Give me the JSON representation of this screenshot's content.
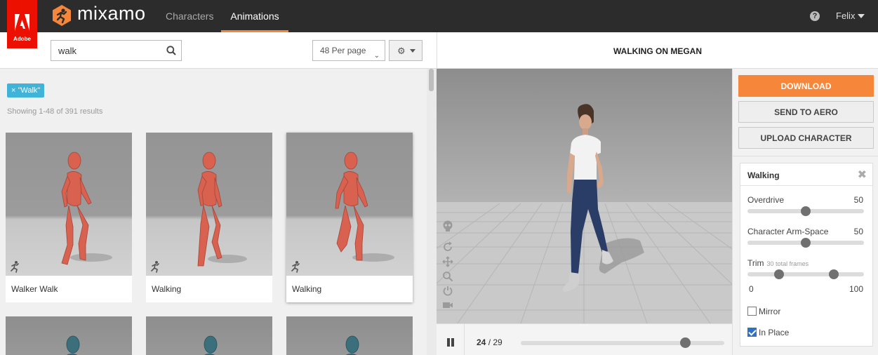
{
  "header": {
    "adobe_label": "Adobe",
    "brand": "mixamo",
    "nav": [
      {
        "label": "Characters"
      },
      {
        "label": "Animations"
      }
    ],
    "active_tab": "Animations",
    "user": "Felix",
    "help_glyph": "?"
  },
  "search": {
    "value": "walk",
    "per_page": "48 Per page"
  },
  "filter_tag": "× \"Walk\"",
  "results_text": "Showing 1-48 of 391 results",
  "cards": [
    {
      "name": "Walker Walk",
      "selected": false
    },
    {
      "name": "Walking",
      "selected": false
    },
    {
      "name": "Walking",
      "selected": true
    }
  ],
  "preview": {
    "title": "WALKING ON MEGAN",
    "frame_current": "24",
    "frame_total": "/ 29",
    "timeline_progress": 0.81
  },
  "actions": {
    "download": "DOWNLOAD",
    "send_to_aero": "SEND TO AERO",
    "upload_character": "UPLOAD CHARACTER"
  },
  "settings": {
    "title": "Walking",
    "close_glyph": "✖",
    "overdrive": {
      "label": "Overdrive",
      "value": "50",
      "fraction": 0.5
    },
    "arm_space": {
      "label": "Character Arm-Space",
      "value": "50",
      "fraction": 0.5
    },
    "trim": {
      "label": "Trim",
      "note": "30 total frames",
      "min": "0",
      "max": "100",
      "start_fraction": 0.27,
      "end_fraction": 0.74
    },
    "mirror": {
      "label": "Mirror",
      "checked": false
    },
    "in_place": {
      "label": "In Place",
      "checked": true
    }
  },
  "colors": {
    "accent": "#f6873a",
    "tag": "#3fb4d8",
    "adobe_red": "#eb1000",
    "robot_red": "#d9614f",
    "robot_teal": "#3b6f7c",
    "checkbox_blue": "#2f72c5"
  },
  "icons": {
    "search": "search-icon",
    "settings": "gear-icon",
    "help": "help-icon",
    "close": "close-icon",
    "pause": "pause-icon",
    "walk": "walking-figure-icon"
  }
}
